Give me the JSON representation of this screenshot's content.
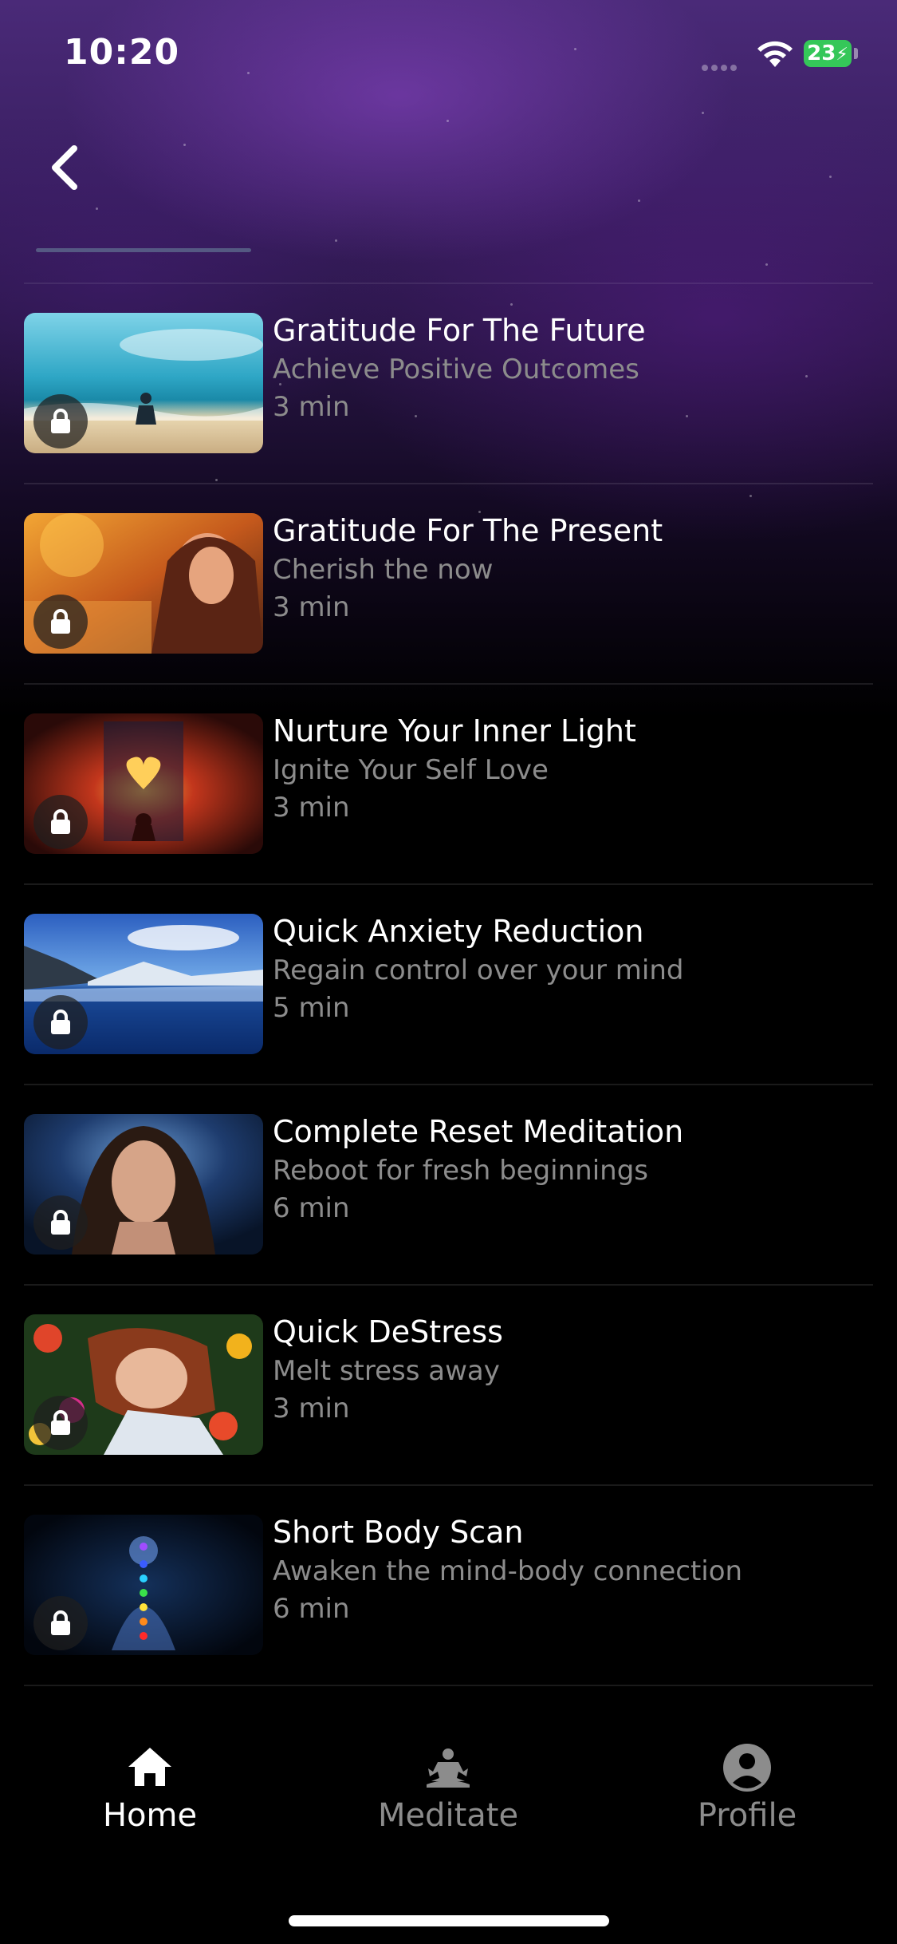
{
  "status_bar": {
    "time": "10:20",
    "battery": "23"
  },
  "sessions": [
    {
      "title": "Gratitude For The Future",
      "subtitle": "Achieve Positive Outcomes",
      "duration": "3 min",
      "locked": true
    },
    {
      "title": "Gratitude For The Present",
      "subtitle": "Cherish the now",
      "duration": "3 min",
      "locked": true
    },
    {
      "title": "Nurture Your Inner Light",
      "subtitle": "Ignite Your Self Love",
      "duration": "3 min",
      "locked": true
    },
    {
      "title": "Quick Anxiety Reduction",
      "subtitle": "Regain control over your mind",
      "duration": "5 min",
      "locked": true
    },
    {
      "title": "Complete Reset Meditation",
      "subtitle": "Reboot for fresh beginnings",
      "duration": "6 min",
      "locked": true
    },
    {
      "title": "Quick DeStress",
      "subtitle": "Melt stress away",
      "duration": "3 min",
      "locked": true
    },
    {
      "title": "Short Body Scan",
      "subtitle": "Awaken the mind-body connection",
      "duration": "6 min",
      "locked": true
    }
  ],
  "tabbar": {
    "home": {
      "label": "Home",
      "icon": "home-icon",
      "active": true
    },
    "meditate": {
      "label": "Meditate",
      "icon": "meditate-icon",
      "active": false
    },
    "profile": {
      "label": "Profile",
      "icon": "profile-icon",
      "active": false
    }
  },
  "colors": {
    "accent_active": "#ffffff",
    "inactive": "#8c8c8c",
    "battery": "#35c759",
    "background": "#000000"
  }
}
